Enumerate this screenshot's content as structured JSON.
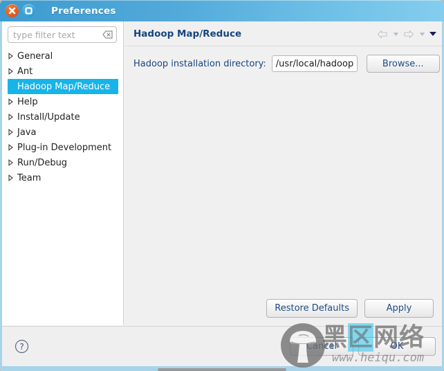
{
  "window": {
    "title": "Preferences",
    "close_icon": "close-x-icon",
    "maximize_icon": "maximize-square-icon",
    "titlebar_gradient_from": "#3d9bcf",
    "titlebar_gradient_to": "#84cdee",
    "frame_color": "#a8d4ea"
  },
  "sidebar": {
    "filter": {
      "placeholder": "type filter text",
      "value": "",
      "clear_icon": "clear-backspace-icon"
    },
    "selection_color": "#17b4e9",
    "items": [
      {
        "label": "General",
        "expandable": true,
        "selected": false
      },
      {
        "label": "Ant",
        "expandable": true,
        "selected": false
      },
      {
        "label": "Hadoop Map/Reduce",
        "expandable": false,
        "selected": true
      },
      {
        "label": "Help",
        "expandable": true,
        "selected": false
      },
      {
        "label": "Install/Update",
        "expandable": true,
        "selected": false
      },
      {
        "label": "Java",
        "expandable": true,
        "selected": false
      },
      {
        "label": "Plug-in Development",
        "expandable": true,
        "selected": false
      },
      {
        "label": "Run/Debug",
        "expandable": true,
        "selected": false
      },
      {
        "label": "Team",
        "expandable": true,
        "selected": false
      }
    ]
  },
  "content": {
    "page_title": "Hadoop Map/Reduce",
    "title_color": "#16467f",
    "nav": {
      "back_icon": "arrow-left-icon",
      "back_menu_icon": "chevron-down-icon",
      "forward_icon": "arrow-right-icon",
      "forward_menu_icon": "chevron-down-icon",
      "overflow_menu_icon": "chevron-down-filled-icon",
      "back_enabled": false,
      "forward_enabled": false
    },
    "form": {
      "directory_label": "Hadoop installation directory:",
      "directory_value": "/usr/local/hadoop",
      "directory_placeholder": "",
      "browse_label": "Browse..."
    },
    "lower_actions": {
      "restore_defaults_label": "Restore Defaults",
      "apply_label": "Apply"
    }
  },
  "footer": {
    "help_icon": "help-question-icon",
    "cancel_label": "Cancel",
    "ok_label": "OK"
  },
  "watermark": {
    "logo_icon": "mushroom-logo-icon",
    "text_part1": "黑",
    "text_highlight": "区",
    "text_part2": "网络",
    "url": "www.heiqu.com",
    "highlight_color": "#40c8eb"
  }
}
